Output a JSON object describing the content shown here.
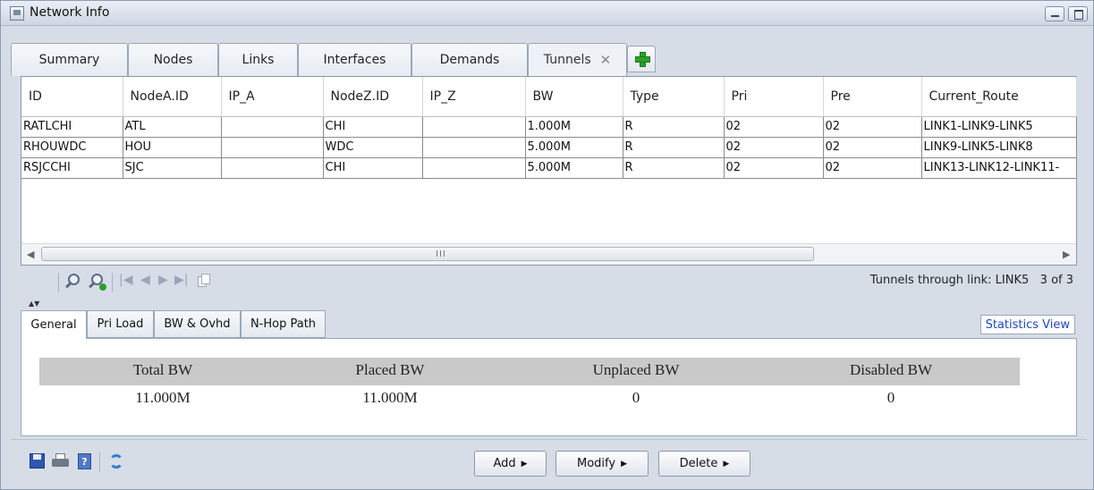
{
  "window": {
    "title": "Network Info"
  },
  "tabs": [
    {
      "label": "Summary"
    },
    {
      "label": "Nodes"
    },
    {
      "label": "Links"
    },
    {
      "label": "Interfaces"
    },
    {
      "label": "Demands"
    },
    {
      "label": "Tunnels",
      "close": "✕"
    }
  ],
  "table": {
    "columns": [
      "ID",
      "NodeA.ID",
      "IP_A",
      "NodeZ.ID",
      "IP_Z",
      "BW",
      "Type",
      "Pri",
      "Pre",
      "Current_Route"
    ],
    "rows": [
      [
        "RATLCHI",
        "ATL",
        "",
        "CHI",
        "",
        "1.000M",
        "R",
        "02",
        "02",
        "LINK1-LINK9-LINK5"
      ],
      [
        "RHOUWDC",
        "HOU",
        "",
        "WDC",
        "",
        "5.000M",
        "R",
        "02",
        "02",
        "LINK9-LINK5-LINK8"
      ],
      [
        "RSJCCHI",
        "SJC",
        "",
        "CHI",
        "",
        "5.000M",
        "R",
        "02",
        "02",
        "LINK13-LINK12-LINK11-"
      ]
    ]
  },
  "scrollbar": {
    "left_arrow": "◀",
    "right_arrow": "▶",
    "grip": "III"
  },
  "navbar": {
    "first": "|◀",
    "prev": "◀",
    "next": "▶",
    "last": "▶|",
    "status_text": "Tunnels through link: LINK5   3 of 3"
  },
  "splitter": "▲▼",
  "lower_tabs": [
    {
      "label": "General"
    },
    {
      "label": "Pri Load"
    },
    {
      "label": "BW & Ovhd"
    },
    {
      "label": "N-Hop Path"
    }
  ],
  "statistics_view": "Statistics View",
  "stats": {
    "headers": [
      "Total BW",
      "Placed BW",
      "Unplaced BW",
      "Disabled BW"
    ],
    "values": [
      "11.000M",
      "11.000M",
      "0",
      "0"
    ]
  },
  "buttons": {
    "add": "Add",
    "modify": "Modify",
    "delete": "Delete",
    "caret": "▶"
  },
  "colors": {
    "link": "#1a46c8",
    "plus": "#2aa12a",
    "title_bg": "#d7dde7"
  }
}
